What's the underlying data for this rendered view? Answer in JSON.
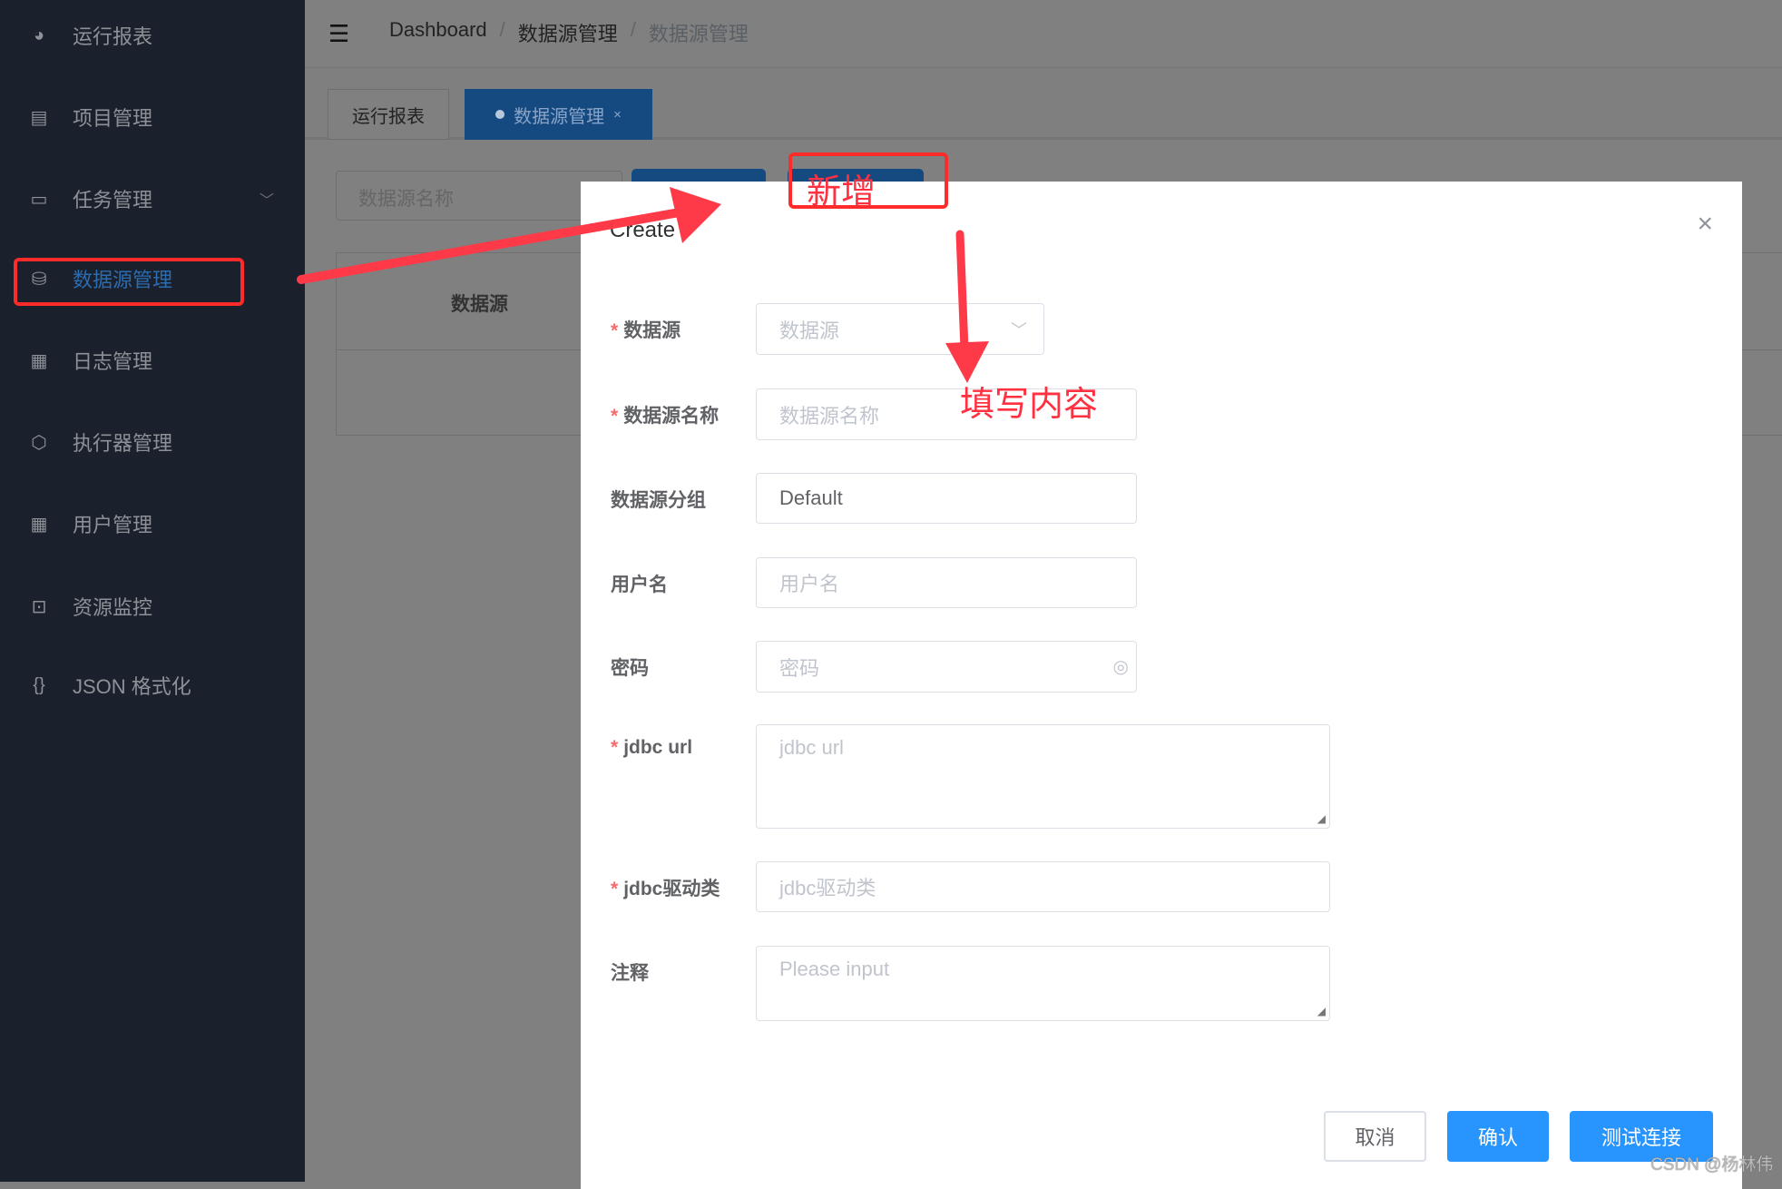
{
  "sidebar": {
    "items": [
      {
        "label": "运行报表",
        "icon": "dashboard-icon"
      },
      {
        "label": "项目管理",
        "icon": "project-icon"
      },
      {
        "label": "任务管理",
        "icon": "monitor-icon",
        "expandable": true
      },
      {
        "label": "数据源管理",
        "icon": "database-icon",
        "active": true
      },
      {
        "label": "日志管理",
        "icon": "document-icon"
      },
      {
        "label": "执行器管理",
        "icon": "executor-icon"
      },
      {
        "label": "用户管理",
        "icon": "grid-icon"
      },
      {
        "label": "资源监控",
        "icon": "monitor-resource-icon"
      },
      {
        "label": "JSON 格式化",
        "icon": "braces-icon"
      }
    ]
  },
  "header": {
    "breadcrumb": [
      "Dashboard",
      "数据源管理",
      "数据源管理"
    ],
    "separator": "/"
  },
  "tabs": [
    {
      "label": "运行报表"
    },
    {
      "label": "数据源管理",
      "active": true,
      "close": "×"
    }
  ],
  "background": {
    "search_placeholder": "数据源名称",
    "table_header": "数据源"
  },
  "dialog": {
    "title": "Create",
    "close": "×",
    "fields": [
      {
        "label": "数据源",
        "required": true,
        "placeholder": "数据源",
        "type": "select"
      },
      {
        "label": "数据源名称",
        "required": true,
        "placeholder": "数据源名称"
      },
      {
        "label": "数据源分组",
        "value": "Default"
      },
      {
        "label": "用户名",
        "placeholder": "用户名"
      },
      {
        "label": "密码",
        "placeholder": "密码",
        "type": "password"
      },
      {
        "label": "jdbc url",
        "required": true,
        "placeholder": "jdbc url",
        "type": "textarea"
      },
      {
        "label": "jdbc驱动类",
        "required": true,
        "placeholder": "jdbc驱动类"
      },
      {
        "label": "注释",
        "placeholder": "Please input",
        "type": "textarea"
      }
    ],
    "buttons": {
      "cancel": "取消",
      "confirm": "确认",
      "test": "测试连接"
    }
  },
  "annotations": {
    "add": "新增",
    "fill": "填写内容",
    "color": "#ff3040"
  },
  "watermark": "CSDN @杨林伟",
  "colors": {
    "primary": "#2894fe",
    "sidebar": "#1b212c",
    "active": "#2b6cb0"
  }
}
